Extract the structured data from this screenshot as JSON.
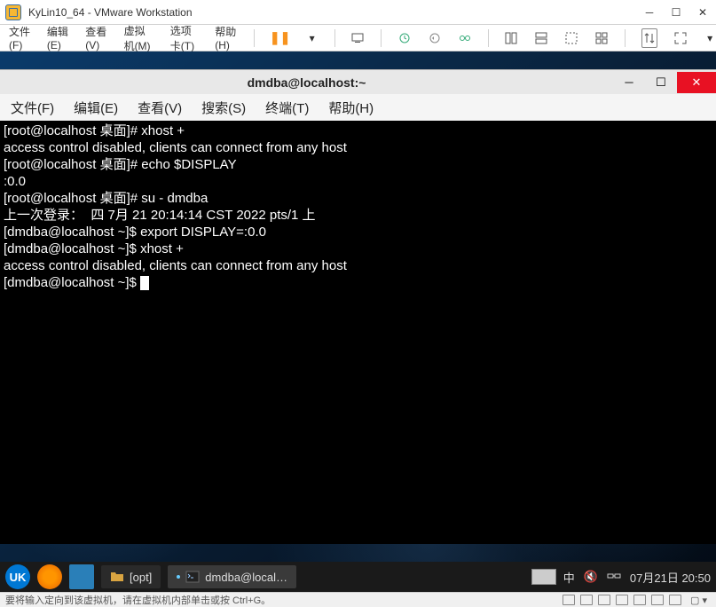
{
  "vmware": {
    "title": "KyLin10_64 - VMware Workstation",
    "menu": {
      "file": "文件(F)",
      "edit": "编辑(E)",
      "view": "查看(V)",
      "vm": "虚拟机(M)",
      "tabs": "选项卡(T)",
      "help": "帮助(H)"
    },
    "status": "要将输入定向到该虚拟机，请在虚拟机内部单击或按 Ctrl+G。"
  },
  "terminal": {
    "title": "dmdba@localhost:~",
    "menu": {
      "file": "文件(F)",
      "edit": "编辑(E)",
      "view": "查看(V)",
      "search": "搜索(S)",
      "terminal": "终端(T)",
      "help": "帮助(H)"
    },
    "lines": [
      "[root@localhost 桌面]# xhost +",
      "access control disabled, clients can connect from any host",
      "[root@localhost 桌面]# echo $DISPLAY",
      ":0.0",
      "[root@localhost 桌面]# su - dmdba",
      "上一次登录：  四 7月 21 20:14:14 CST 2022 pts/1 上",
      "[dmdba@localhost ~]$ export DISPLAY=:0.0",
      "[dmdba@localhost ~]$ xhost +",
      "access control disabled, clients can connect from any host",
      "[dmdba@localhost ~]$ "
    ]
  },
  "taskbar": {
    "items": [
      {
        "label": "[opt]"
      },
      {
        "label": "dmdba@local…"
      }
    ],
    "clock": "07月21日 20:50"
  }
}
